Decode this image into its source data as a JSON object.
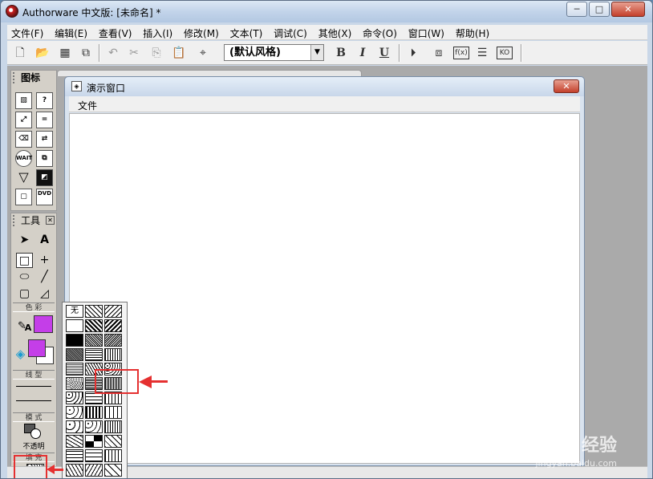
{
  "window": {
    "title": "Authorware 中文版: [未命名] *",
    "min_glyph": "─",
    "max_glyph": "□",
    "close_glyph": "✕"
  },
  "menu": [
    "文件(F)",
    "编辑(E)",
    "查看(V)",
    "插入(I)",
    "修改(M)",
    "文本(T)",
    "调试(C)",
    "其他(X)",
    "命令(O)",
    "窗口(W)",
    "帮助(H)"
  ],
  "toolbar": {
    "style_value": "(默认风格)",
    "bold": "B",
    "italic": "I",
    "underline": "U"
  },
  "icon_palette": {
    "title": "图标",
    "wait_label": "WAIT",
    "dvd_label": "DVD"
  },
  "tools_palette": {
    "title": "工具",
    "text_tool": "A",
    "color_label": "色 彩",
    "line_label": "线 型",
    "mode_label": "模 式",
    "mode_value": "不透明",
    "fill_label": "填 充",
    "fill_color": "#c43ee8"
  },
  "presentation": {
    "title": "演示窗口",
    "menu_file": "文件"
  },
  "fill_popup": {
    "none_label": "无",
    "rows": 12,
    "cols": 3,
    "highlight_color": "#e53030"
  },
  "watermark": {
    "brand": "Bai 经验",
    "url": "jingyan.baidu.com"
  }
}
